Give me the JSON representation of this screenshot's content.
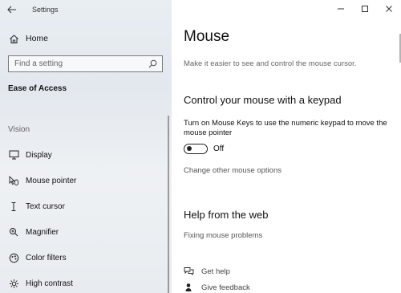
{
  "window": {
    "title": "Settings"
  },
  "sidebar": {
    "home_label": "Home",
    "search_placeholder": "Find a setting",
    "section_title": "Ease of Access",
    "group_label": "Vision",
    "items": [
      {
        "label": "Display",
        "icon": "monitor-icon"
      },
      {
        "label": "Mouse pointer",
        "icon": "mouse-pointer-icon"
      },
      {
        "label": "Text cursor",
        "icon": "text-cursor-icon"
      },
      {
        "label": "Magnifier",
        "icon": "magnifier-icon"
      },
      {
        "label": "Color filters",
        "icon": "color-filters-icon"
      },
      {
        "label": "High contrast",
        "icon": "high-contrast-icon"
      }
    ]
  },
  "main": {
    "title": "Mouse",
    "subtitle": "Make it easier to see and control the mouse cursor.",
    "keypad_heading": "Control your mouse with a keypad",
    "mouse_keys_desc": "Turn on Mouse Keys to use the numeric keypad to move the mouse pointer",
    "toggle_state": "Off",
    "other_options_link": "Change other mouse options",
    "help_heading": "Help from the web",
    "help_link": "Fixing mouse problems",
    "get_help": "Get help",
    "give_feedback": "Give feedback"
  }
}
